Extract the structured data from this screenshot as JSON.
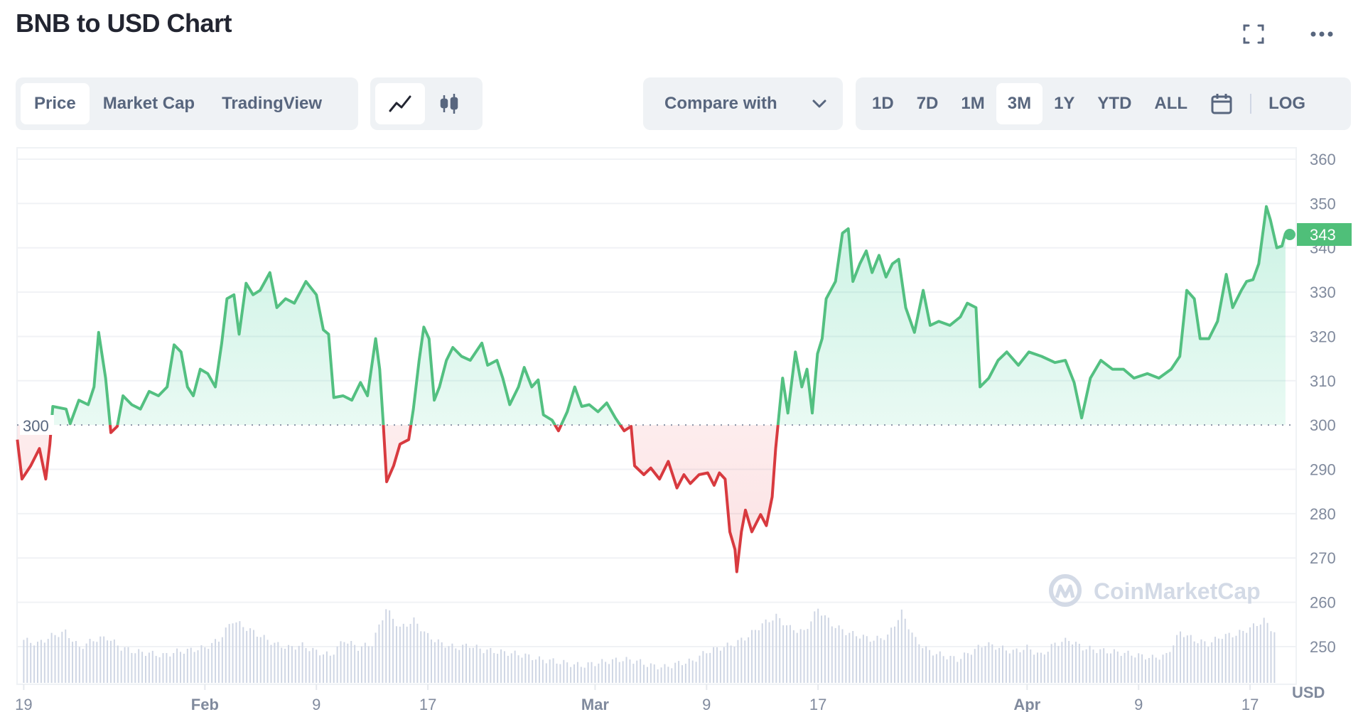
{
  "header": {
    "title": "BNB to USD Chart",
    "fullscreen_icon": "expand-icon",
    "more_icon": "more-horizontal-icon"
  },
  "toolbar": {
    "view_tabs": [
      {
        "label": "Price",
        "active": true
      },
      {
        "label": "Market Cap",
        "active": false
      },
      {
        "label": "TradingView",
        "active": false
      }
    ],
    "chart_types": [
      {
        "icon": "line-chart-icon",
        "active": true
      },
      {
        "icon": "candlestick-icon",
        "active": false
      }
    ],
    "compare": {
      "label": "Compare with",
      "icon": "chevron-down-icon"
    },
    "timeframes": [
      {
        "label": "1D"
      },
      {
        "label": "7D"
      },
      {
        "label": "1M"
      },
      {
        "label": "3M",
        "active": true
      },
      {
        "label": "1Y"
      },
      {
        "label": "YTD"
      },
      {
        "label": "ALL"
      }
    ],
    "calendar_icon": "calendar-icon",
    "log_label": "LOG"
  },
  "watermark": "CoinMarketCap",
  "colors": {
    "up": "#16c784",
    "line_up": "#53c081",
    "down": "#d83a3f",
    "axis_text": "#808a9d",
    "badge": "#4fbf79",
    "volume": "#cfd6e4"
  },
  "chart_data": {
    "type": "line",
    "title": "",
    "ylabel": "USD",
    "ylim": [
      245,
      362
    ],
    "yticks": [
      360,
      350,
      340,
      330,
      320,
      310,
      300,
      290,
      280,
      270,
      260,
      250
    ],
    "reference_value": 300,
    "reference_label": "300",
    "current_price": 343,
    "current_label": "343",
    "grid": true,
    "xticks": [
      {
        "date": "01-19 00",
        "label": "19",
        "bold": false
      },
      {
        "date": "02-01 00",
        "label": "Feb",
        "bold": true
      },
      {
        "date": "02-09 00",
        "label": "9",
        "bold": false
      },
      {
        "date": "02-17 00",
        "label": "17",
        "bold": false
      },
      {
        "date": "03-01 00",
        "label": "Mar",
        "bold": true
      },
      {
        "date": "03-09 00",
        "label": "9",
        "bold": false
      },
      {
        "date": "03-17 00",
        "label": "17",
        "bold": false
      },
      {
        "date": "04-01 00",
        "label": "Apr",
        "bold": true
      },
      {
        "date": "04-09 00",
        "label": "9",
        "bold": false
      },
      {
        "date": "04-17 00",
        "label": "17",
        "bold": false
      }
    ],
    "price": [
      [
        "01-18 13",
        296.7
      ],
      [
        "01-18 21",
        287.8
      ],
      [
        "01-19 12",
        290.8
      ],
      [
        "01-20 03",
        294.7
      ],
      [
        "01-20 14",
        287.8
      ],
      [
        "01-20 21",
        295.7
      ],
      [
        "01-21 02",
        304.2
      ],
      [
        "01-22 01",
        303.6
      ],
      [
        "01-22 08",
        300.3
      ],
      [
        "01-22 23",
        305.6
      ],
      [
        "01-23 15",
        304.6
      ],
      [
        "01-24 01",
        308.6
      ],
      [
        "01-24 09",
        320.9
      ],
      [
        "01-24 21",
        310.6
      ],
      [
        "01-25 06",
        298.3
      ],
      [
        "01-25 17",
        299.7
      ],
      [
        "01-26 03",
        306.6
      ],
      [
        "01-26 18",
        304.6
      ],
      [
        "01-27 09",
        303.6
      ],
      [
        "01-28 00",
        307.6
      ],
      [
        "01-28 16",
        306.6
      ],
      [
        "01-29 07",
        308.6
      ],
      [
        "01-29 19",
        318.1
      ],
      [
        "01-30 07",
        316.5
      ],
      [
        "01-30 18",
        308.6
      ],
      [
        "01-31 04",
        306.6
      ],
      [
        "01-31 16",
        312.6
      ],
      [
        "02-01 05",
        311.6
      ],
      [
        "02-01 18",
        308.6
      ],
      [
        "02-02 05",
        318.5
      ],
      [
        "02-02 14",
        328.5
      ],
      [
        "02-03 02",
        329.4
      ],
      [
        "02-03 11",
        320.5
      ],
      [
        "02-03 23",
        332.0
      ],
      [
        "02-04 11",
        329.4
      ],
      [
        "02-04 23",
        330.4
      ],
      [
        "02-05 16",
        334.4
      ],
      [
        "02-06 04",
        326.5
      ],
      [
        "02-06 19",
        328.5
      ],
      [
        "02-07 10",
        327.5
      ],
      [
        "02-08 06",
        332.4
      ],
      [
        "02-09 00",
        329.4
      ],
      [
        "02-09 12",
        321.5
      ],
      [
        "02-09 21",
        320.5
      ],
      [
        "02-10 06",
        306.2
      ],
      [
        "02-10 22",
        306.6
      ],
      [
        "02-11 13",
        305.6
      ],
      [
        "02-12 04",
        309.6
      ],
      [
        "02-12 16",
        306.6
      ],
      [
        "02-13 06",
        319.5
      ],
      [
        "02-13 13",
        312.6
      ],
      [
        "02-13 19",
        300.7
      ],
      [
        "02-14 01",
        287.2
      ],
      [
        "02-14 13",
        290.8
      ],
      [
        "02-15 00",
        295.7
      ],
      [
        "02-15 15",
        296.7
      ],
      [
        "02-15 23",
        303.6
      ],
      [
        "02-16 09",
        314.6
      ],
      [
        "02-16 17",
        322.1
      ],
      [
        "02-17 02",
        319.5
      ],
      [
        "02-17 11",
        305.6
      ],
      [
        "02-17 20",
        308.6
      ],
      [
        "02-18 08",
        314.6
      ],
      [
        "02-18 19",
        317.5
      ],
      [
        "02-19 10",
        315.5
      ],
      [
        "02-20 01",
        314.6
      ],
      [
        "02-20 21",
        318.5
      ],
      [
        "02-21 07",
        313.5
      ],
      [
        "02-21 23",
        314.6
      ],
      [
        "02-22 09",
        310.6
      ],
      [
        "02-22 21",
        304.6
      ],
      [
        "02-23 12",
        308.6
      ],
      [
        "02-23 22",
        313.0
      ],
      [
        "02-24 11",
        308.6
      ],
      [
        "02-24 22",
        310.2
      ],
      [
        "02-25 07",
        302.3
      ],
      [
        "02-25 22",
        301.1
      ],
      [
        "02-26 09",
        298.7
      ],
      [
        "02-27 00",
        303.0
      ],
      [
        "02-27 13",
        308.6
      ],
      [
        "02-28 01",
        304.2
      ],
      [
        "02-28 14",
        304.6
      ],
      [
        "03-01 05",
        303.0
      ],
      [
        "03-01 20",
        305.0
      ],
      [
        "03-02 11",
        301.6
      ],
      [
        "03-03 02",
        298.7
      ],
      [
        "03-03 14",
        299.7
      ],
      [
        "03-03 20",
        290.8
      ],
      [
        "03-04 12",
        288.8
      ],
      [
        "03-05 00",
        290.3
      ],
      [
        "03-05 15",
        287.8
      ],
      [
        "03-06 06",
        291.8
      ],
      [
        "03-06 21",
        285.8
      ],
      [
        "03-07 09",
        288.8
      ],
      [
        "03-07 20",
        286.8
      ],
      [
        "03-08 11",
        288.8
      ],
      [
        "03-09 02",
        289.2
      ],
      [
        "03-09 13",
        286.4
      ],
      [
        "03-09 22",
        289.2
      ],
      [
        "03-10 08",
        287.8
      ],
      [
        "03-10 16",
        275.9
      ],
      [
        "03-11 01",
        271.9
      ],
      [
        "03-11 04",
        266.9
      ],
      [
        "03-11 12",
        275.9
      ],
      [
        "03-11 19",
        280.8
      ],
      [
        "03-12 06",
        275.9
      ],
      [
        "03-12 21",
        279.8
      ],
      [
        "03-13 07",
        277.3
      ],
      [
        "03-13 17",
        283.8
      ],
      [
        "03-13 23",
        294.7
      ],
      [
        "03-14 05",
        302.7
      ],
      [
        "03-14 11",
        310.6
      ],
      [
        "03-14 20",
        302.7
      ],
      [
        "03-15 09",
        316.5
      ],
      [
        "03-15 20",
        308.6
      ],
      [
        "03-16 05",
        312.6
      ],
      [
        "03-16 14",
        302.7
      ],
      [
        "03-16 23",
        316.1
      ],
      [
        "03-17 07",
        319.5
      ],
      [
        "03-17 14",
        328.5
      ],
      [
        "03-18 06",
        332.4
      ],
      [
        "03-18 18",
        343.3
      ],
      [
        "03-19 04",
        344.3
      ],
      [
        "03-19 12",
        332.4
      ],
      [
        "03-20 00",
        336.4
      ],
      [
        "03-20 11",
        339.3
      ],
      [
        "03-20 21",
        334.4
      ],
      [
        "03-21 09",
        338.3
      ],
      [
        "03-21 21",
        333.4
      ],
      [
        "03-22 08",
        336.4
      ],
      [
        "03-22 19",
        337.4
      ],
      [
        "03-23 07",
        326.5
      ],
      [
        "03-23 22",
        320.9
      ],
      [
        "03-24 13",
        330.4
      ],
      [
        "03-25 01",
        322.5
      ],
      [
        "03-25 16",
        323.4
      ],
      [
        "03-26 11",
        322.5
      ],
      [
        "03-27 05",
        324.4
      ],
      [
        "03-27 17",
        327.5
      ],
      [
        "03-28 08",
        326.5
      ],
      [
        "03-28 15",
        308.6
      ],
      [
        "03-29 06",
        310.6
      ],
      [
        "03-29 22",
        314.6
      ],
      [
        "03-30 13",
        316.5
      ],
      [
        "03-31 09",
        313.5
      ],
      [
        "04-01 03",
        316.5
      ],
      [
        "04-02 01",
        315.5
      ],
      [
        "04-03 00",
        314.1
      ],
      [
        "04-03 18",
        314.6
      ],
      [
        "04-04 09",
        309.6
      ],
      [
        "04-04 22",
        301.6
      ],
      [
        "04-05 13",
        310.6
      ],
      [
        "04-06 07",
        314.6
      ],
      [
        "04-07 03",
        312.6
      ],
      [
        "04-07 22",
        312.6
      ],
      [
        "04-08 16",
        310.6
      ],
      [
        "04-09 15",
        311.6
      ],
      [
        "04-10 11",
        310.6
      ],
      [
        "04-11 08",
        312.6
      ],
      [
        "04-11 23",
        315.5
      ],
      [
        "04-12 11",
        330.4
      ],
      [
        "04-13 00",
        328.5
      ],
      [
        "04-13 10",
        319.5
      ],
      [
        "04-14 01",
        319.5
      ],
      [
        "04-14 16",
        323.4
      ],
      [
        "04-15 07",
        334.0
      ],
      [
        "04-15 18",
        326.5
      ],
      [
        "04-16 09",
        330.4
      ],
      [
        "04-16 18",
        332.4
      ],
      [
        "04-17 05",
        332.8
      ],
      [
        "04-17 15",
        336.4
      ],
      [
        "04-18 04",
        349.3
      ],
      [
        "04-18 11",
        346.3
      ],
      [
        "04-18 22",
        340.0
      ],
      [
        "04-19 07",
        340.4
      ],
      [
        "04-19 13",
        343.3
      ]
    ],
    "volume_relative_daily_from_01-19": [
      55,
      50,
      60,
      65,
      45,
      55,
      58,
      45,
      40,
      38,
      35,
      40,
      42,
      45,
      55,
      80,
      70,
      60,
      50,
      45,
      48,
      40,
      35,
      55,
      45,
      50,
      95,
      70,
      80,
      60,
      50,
      45,
      48,
      42,
      40,
      38,
      35,
      30,
      28,
      25,
      22,
      25,
      28,
      30,
      28,
      22,
      20,
      25,
      28,
      40,
      45,
      50,
      60,
      75,
      85,
      70,
      65,
      95,
      75,
      65,
      60,
      55,
      60,
      90,
      55,
      40,
      35,
      30,
      40,
      50,
      45,
      40,
      45,
      35,
      50,
      55,
      45,
      42,
      40,
      38,
      35,
      32,
      35,
      65,
      55,
      50,
      60,
      62,
      70,
      80,
      60
    ]
  }
}
